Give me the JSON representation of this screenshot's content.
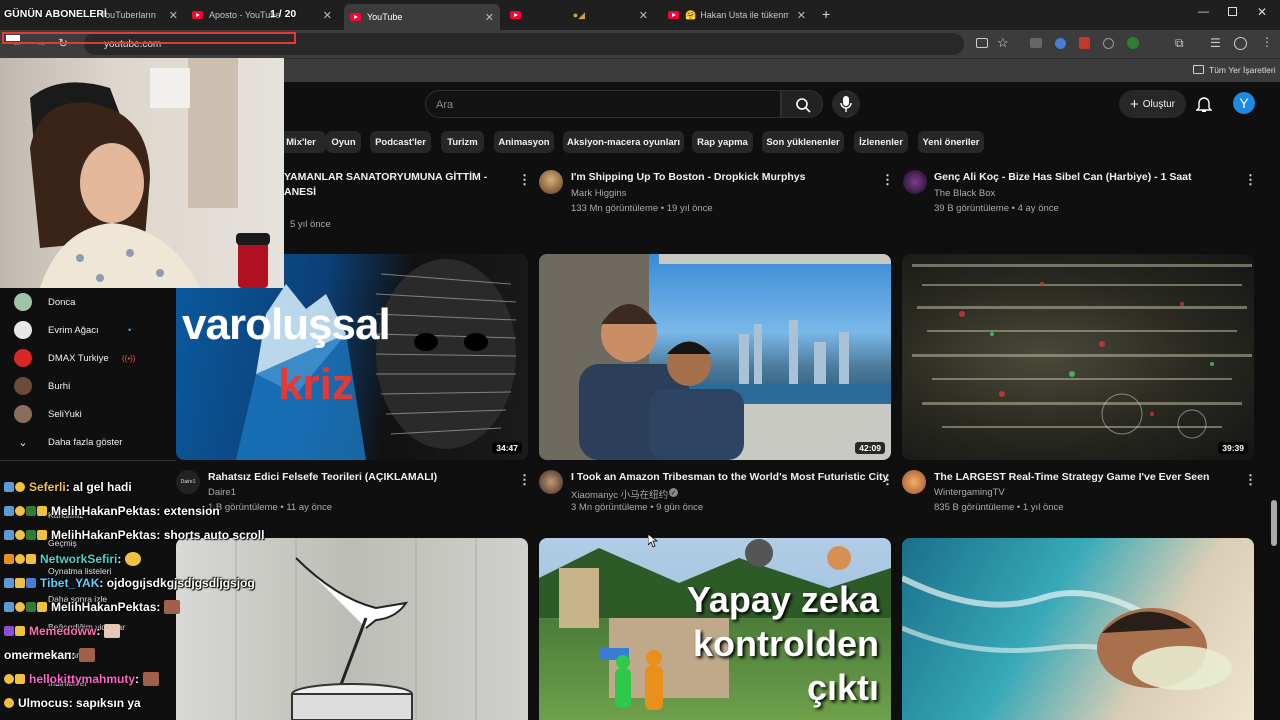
{
  "browser": {
    "tabs": [
      {
        "label": "YouTuberların"
      },
      {
        "label": "Aposto - YouTube"
      },
      {
        "label": "YouTube"
      },
      {
        "label": ""
      },
      {
        "label": ""
      },
      {
        "label": "Hakan Usta ile tükenmez sa"
      }
    ],
    "url": "youtube.com",
    "bookmarks_folder": "Tüm Yer İşaretleri"
  },
  "overlay": {
    "subs_label": "GÜNÜN ABONELERİ",
    "subs_counter": "1 / 20"
  },
  "youtube": {
    "search_placeholder": "Ara",
    "create_label": "Oluştur",
    "avatar_letter": "Y",
    "chips": [
      "Mix'ler",
      "Oyun",
      "Podcast'ler",
      "Turizm",
      "Animasyon",
      "Aksiyon-macera oyunları",
      "Rap yapma",
      "Son yüklenenler",
      "İzlenenler",
      "Yeni öneriler"
    ],
    "row1": [
      {
        "title_l1": "YAMANLAR SANATORYUMUNA GİTTİM -",
        "title_l2": "ANESİ",
        "meta": "5 yıl önce"
      },
      {
        "title": "I'm Shipping Up To Boston - Dropkick Murphys",
        "channel": "Mark Higgins",
        "meta": "133 Mn görüntüleme • 19 yıl önce"
      },
      {
        "title": "Genç Ali Koç - Bize Has Sibel Can (Harbiye) - 1 Saat",
        "channel": "The Black Box",
        "meta": "39 B görüntüleme • 4 ay önce"
      }
    ],
    "row2": [
      {
        "thumb_text_1": "varoluşsal",
        "thumb_text_2": "kriz",
        "duration": "34:47",
        "title": "Rahatsız Edici Felsefe Teorileri (AÇIKLAMALI)",
        "channel": "Daire1",
        "meta": "1 B görüntüleme • 11 ay önce",
        "avatar_text": "Daire1"
      },
      {
        "duration": "42:09",
        "title": "I Took an Amazon Tribesman to the World's Most Futuristic City",
        "channel": "Xiaomanyc 小马在纽约",
        "meta": "3 Mn görüntüleme • 9 gün önce"
      },
      {
        "duration": "39:39",
        "title": "The LARGEST Real-Time Strategy Game I've Ever Seen",
        "channel": "WintergamingTV",
        "meta": "835 B görüntüleme • 1 yıl önce"
      }
    ],
    "row3": [
      {},
      {
        "thumb_text_1": "Yapay zeka",
        "thumb_text_2": "kontrolden",
        "thumb_text_3": "çıktı"
      },
      {}
    ],
    "sidebar": {
      "subscriptions": [
        {
          "name": "Donca",
          "color": "#9fc5a8"
        },
        {
          "name": "Evrim Ağacı",
          "color": "#e8e8e8",
          "indicator": "•"
        },
        {
          "name": "DMAX Turkiye",
          "color": "#d62828",
          "indicator": "((•))"
        },
        {
          "name": "Burhi",
          "color": "#6b4a3a"
        },
        {
          "name": "SeliYuki",
          "color": "#8a6d5c"
        }
      ],
      "show_more": "Daha fazla göster",
      "hidden_items": [
        "Kanalınız",
        "Geçmiş",
        "Oynatma listeleri",
        "Daha sonra izle",
        "Beğendiğim videolar",
        "Videolarım",
        "İndirilenler"
      ]
    }
  },
  "chat": [
    {
      "user": "Seferli",
      "color": "#f5c242",
      "msg": " : al gel hadi"
    },
    {
      "user": "MelihHakanPektas",
      "color": "#ffffff",
      "msg": " : extension"
    },
    {
      "user": "MelihHakanPektas",
      "color": "#ffffff",
      "msg": " : shorts auto scroll"
    },
    {
      "user": "NetworkSefiri",
      "color": "#4fd1c5",
      "msg": " :"
    },
    {
      "user": "Tibet_YAK",
      "color": "#5fd0ff",
      "msg": " : ojdogıjsdkgjsdjgsdljgsjog"
    },
    {
      "user": "MelihHakanPektas",
      "color": "#ffffff",
      "msg": " :"
    },
    {
      "user": "Memedoww",
      "color": "#ff6fb0",
      "msg": " :"
    },
    {
      "user": "omermekan",
      "color": "#ffffff",
      "msg": " :"
    },
    {
      "user": "hellokittymahmuty",
      "color": "#ff66cc",
      "msg": " :"
    },
    {
      "user": "Ulmocus",
      "color": "#ffffff",
      "msg": " : sapıksın ya"
    }
  ],
  "colors": {
    "accent": "#ff0033",
    "bg": "#0f0f0f",
    "chip": "#272727"
  }
}
